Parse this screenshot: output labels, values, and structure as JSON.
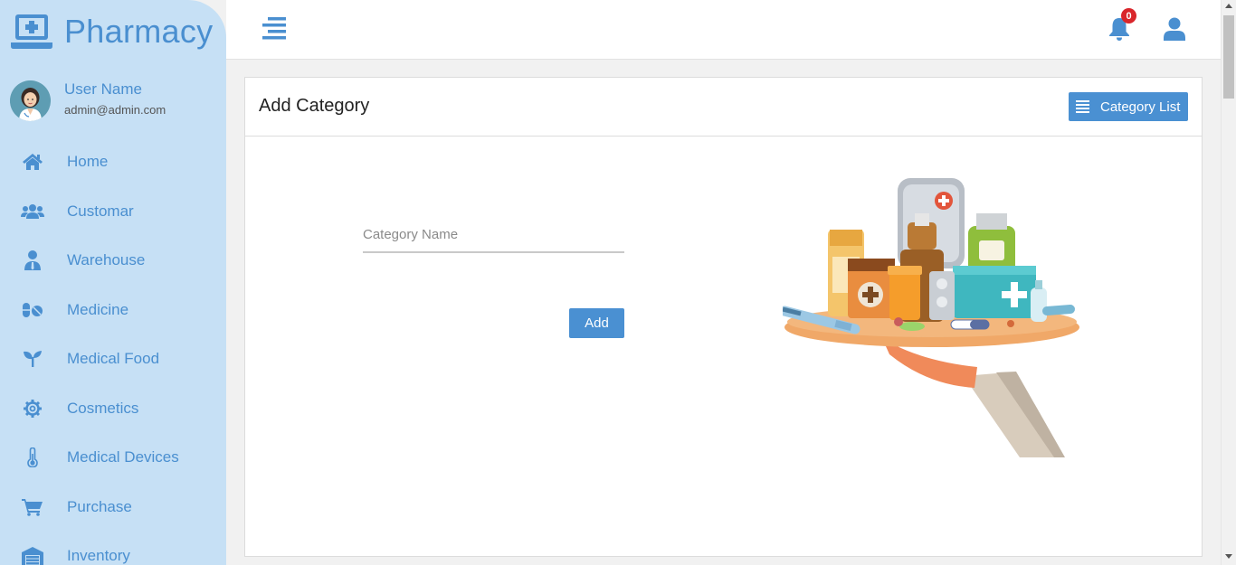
{
  "brand": {
    "name": "Pharmacy",
    "icon": "laptop-medical-icon"
  },
  "profile": {
    "name": "User Name",
    "email": "admin@admin.com"
  },
  "nav": [
    {
      "label": "Home",
      "icon": "home-icon"
    },
    {
      "label": "Customar",
      "icon": "users-icon"
    },
    {
      "label": "Warehouse",
      "icon": "user-tie-icon"
    },
    {
      "label": "Medicine",
      "icon": "pills-icon"
    },
    {
      "label": "Medical Food",
      "icon": "seedling-icon"
    },
    {
      "label": "Cosmetics",
      "icon": "gear-icon"
    },
    {
      "label": "Medical Devices",
      "icon": "thermometer-icon"
    },
    {
      "label": "Purchase",
      "icon": "cart-icon"
    },
    {
      "label": "Inventory",
      "icon": "warehouse-icon"
    }
  ],
  "topbar": {
    "notifications_count": "0"
  },
  "card": {
    "title": "Add Category",
    "list_button_label": "Category List",
    "field_placeholder": "Category Name",
    "field_value": "",
    "add_button_label": "Add"
  },
  "colors": {
    "accent": "#4a90d2",
    "sidebar_bg": "#c6e0f5",
    "badge": "#d9262b"
  }
}
